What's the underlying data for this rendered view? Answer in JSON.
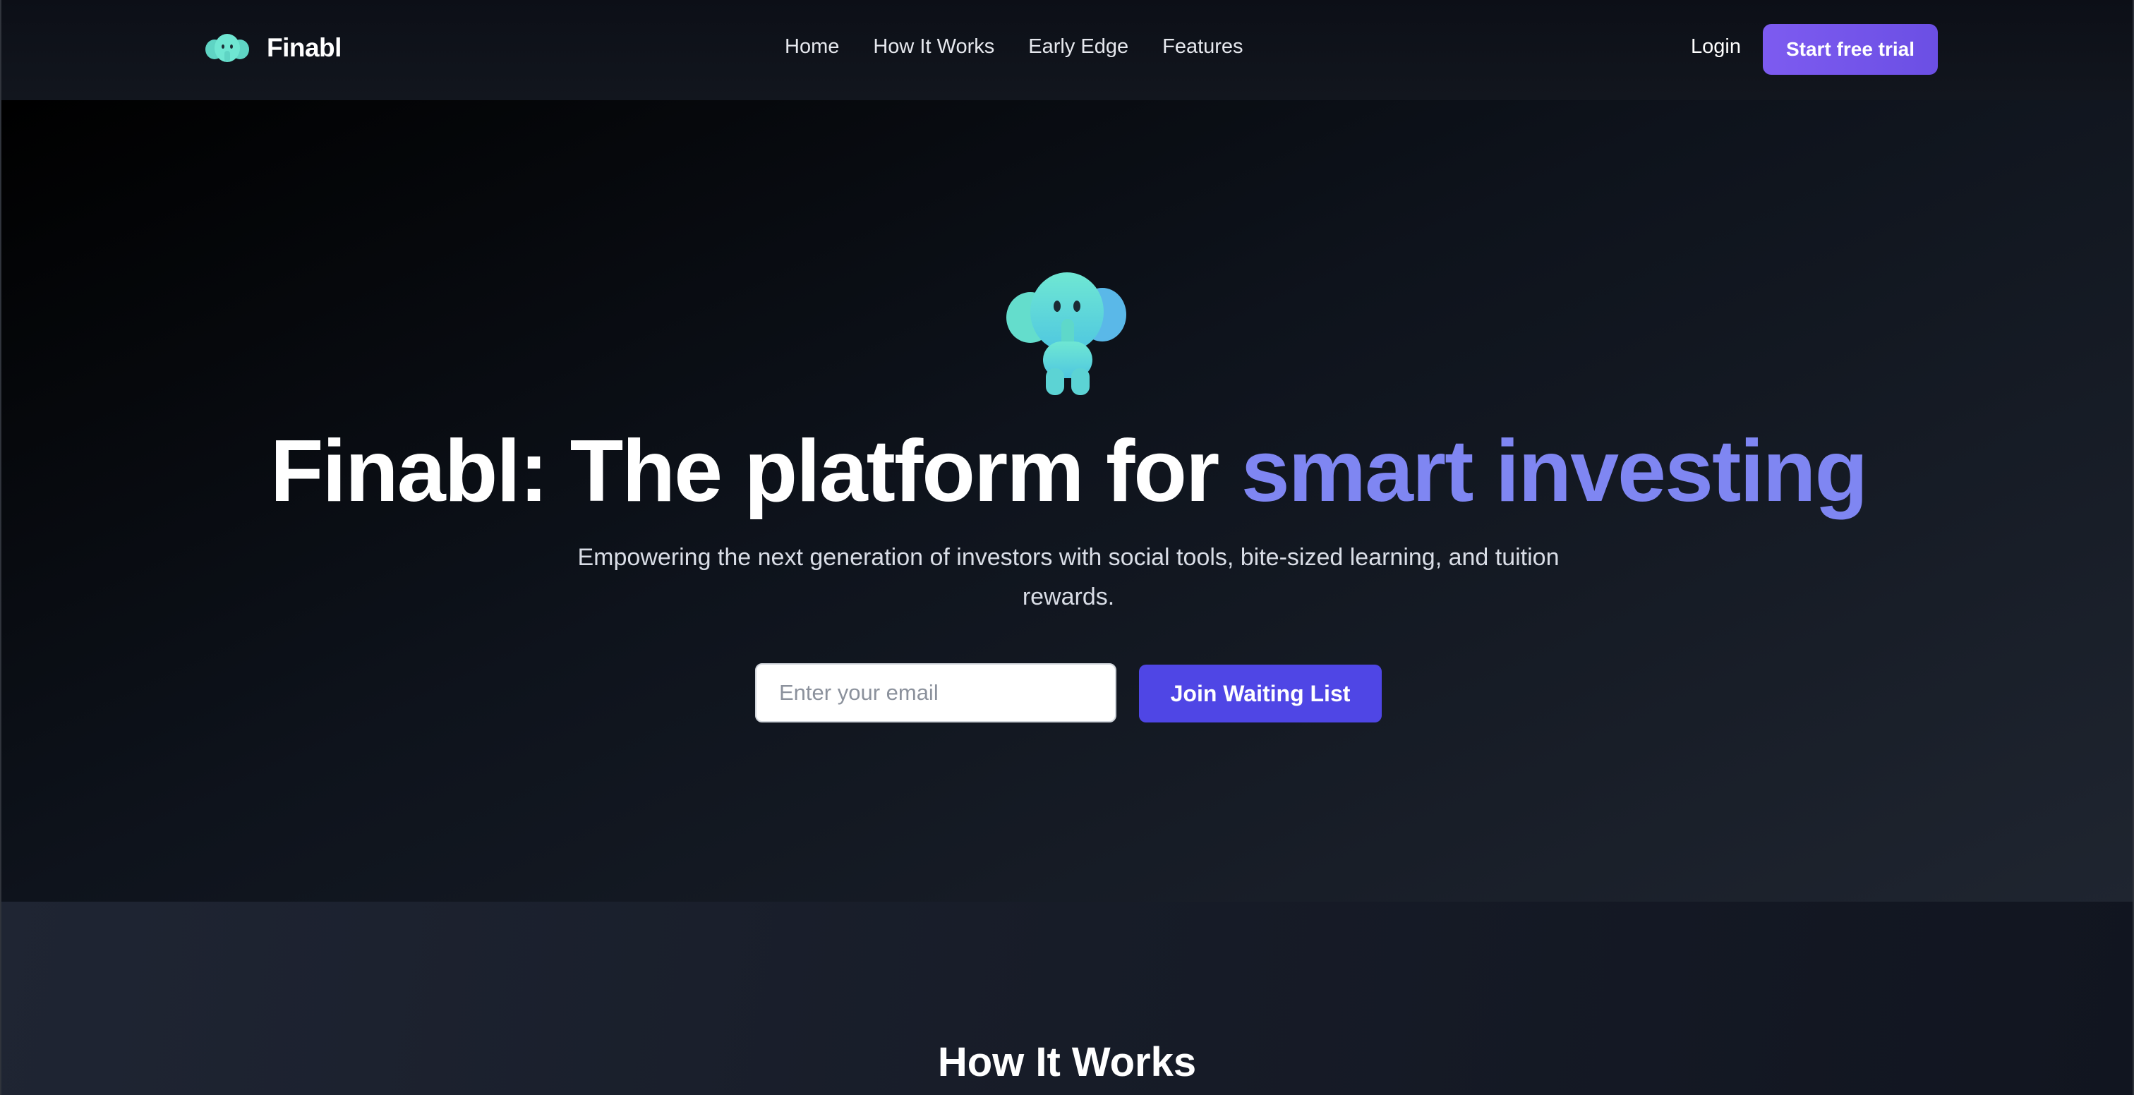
{
  "brand": {
    "name": "Finabl",
    "logo_icon": "elephant-logo-icon"
  },
  "nav": {
    "links": [
      "Home",
      "How It Works",
      "Early Edge",
      "Features"
    ],
    "login": "Login",
    "cta": "Start free trial"
  },
  "hero": {
    "mascot_icon": "elephant-mascot-icon",
    "headline_main": "Finabl: The platform for ",
    "headline_accent": "smart investing",
    "subtitle": "Empowering the next generation of investors with social tools, bite-sized learning, and tuition rewards.",
    "email_placeholder": "Enter your email",
    "join_button": "Join Waiting List"
  },
  "section": {
    "title": "How It Works"
  },
  "colors": {
    "accent_text": "#7f86f2",
    "cta_purple": "#7d5bf0",
    "join_button": "#4f46e5",
    "mascot_teal": "#5ee6cf"
  }
}
